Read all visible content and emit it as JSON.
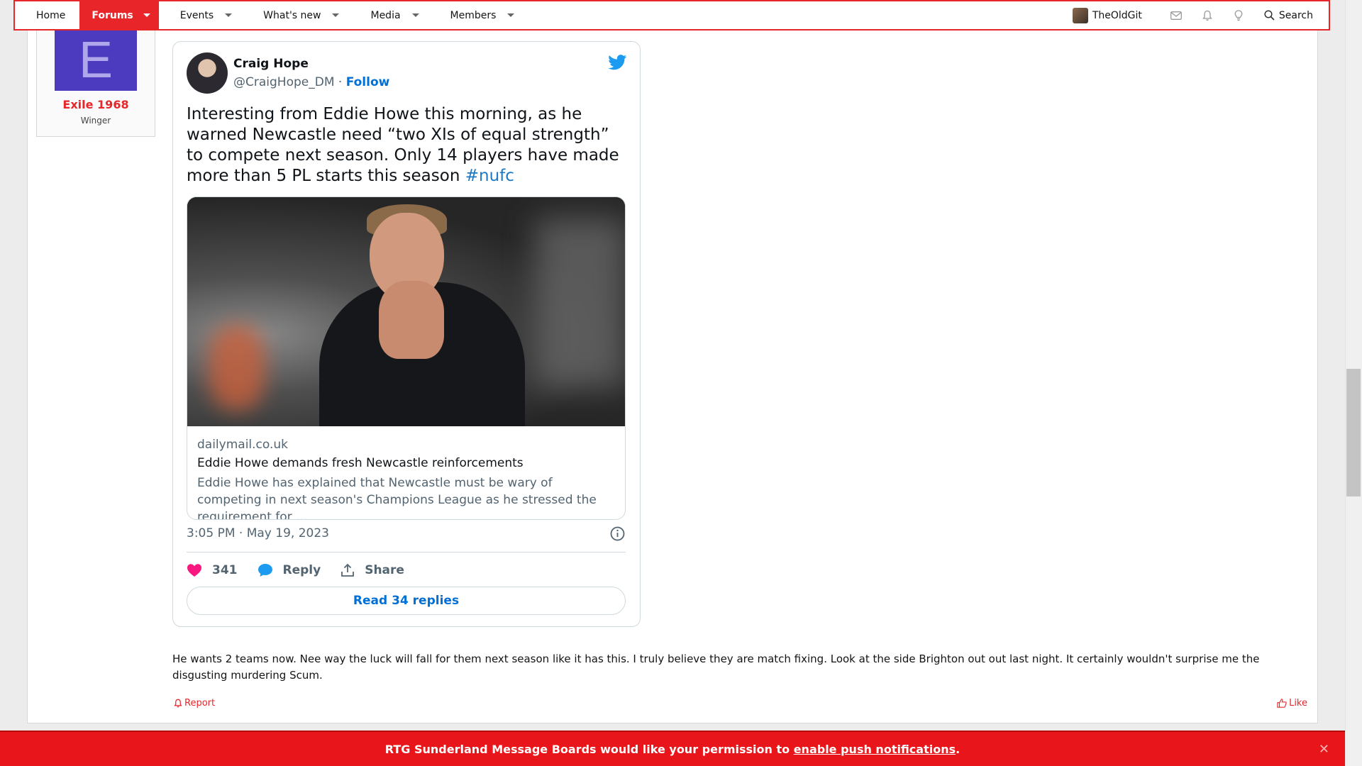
{
  "nav": {
    "items": [
      {
        "label": "Home"
      },
      {
        "label": "Forums"
      },
      {
        "label": "Events"
      },
      {
        "label": "What's new"
      },
      {
        "label": "Media"
      },
      {
        "label": "Members"
      }
    ],
    "username": "TheOldGit",
    "search_label": "Search"
  },
  "poster": {
    "avatar_letter": "E",
    "name": "Exile 1968",
    "title": "Winger"
  },
  "tweet": {
    "name": "Craig Hope",
    "handle": "@CraigHope_DM",
    "separator": " · ",
    "follow": "Follow",
    "text": "Interesting from Eddie Howe this morning, as he warned Newcastle need “two XIs of equal strength” to compete next season. Only 14 players have made more than 5 PL starts this season ",
    "hashtag": "#nufc",
    "card": {
      "domain": "dailymail.co.uk",
      "title": "Eddie Howe demands fresh Newcastle reinforcements",
      "description": "Eddie Howe has explained that Newcastle must be wary of competing in next season's Champions League as he stressed the requirement for ..."
    },
    "timestamp": "3:05 PM · May 19, 2023",
    "likes": "341",
    "reply_label": "Reply",
    "share_label": "Share",
    "read_replies": "Read 34 replies"
  },
  "post": {
    "text": "He wants 2 teams now. Nee way the luck will fall for them next season like it has this. I truly believe they are match fixing. Look at the side Brighton out out last night. It certainly wouldn't surprise me the disgusting murdering Scum.",
    "report_label": "Report",
    "like_label": "Like"
  },
  "notice": {
    "text_before": "RTG Sunderland Message Boards would like your permission to ",
    "link": "enable push notifications",
    "text_after": ".",
    "close": "✕"
  },
  "colors": {
    "accent": "#e8262a",
    "twitter_blue": "#1d9bf0",
    "link_blue": "#006fd6",
    "heart": "#f91880"
  }
}
